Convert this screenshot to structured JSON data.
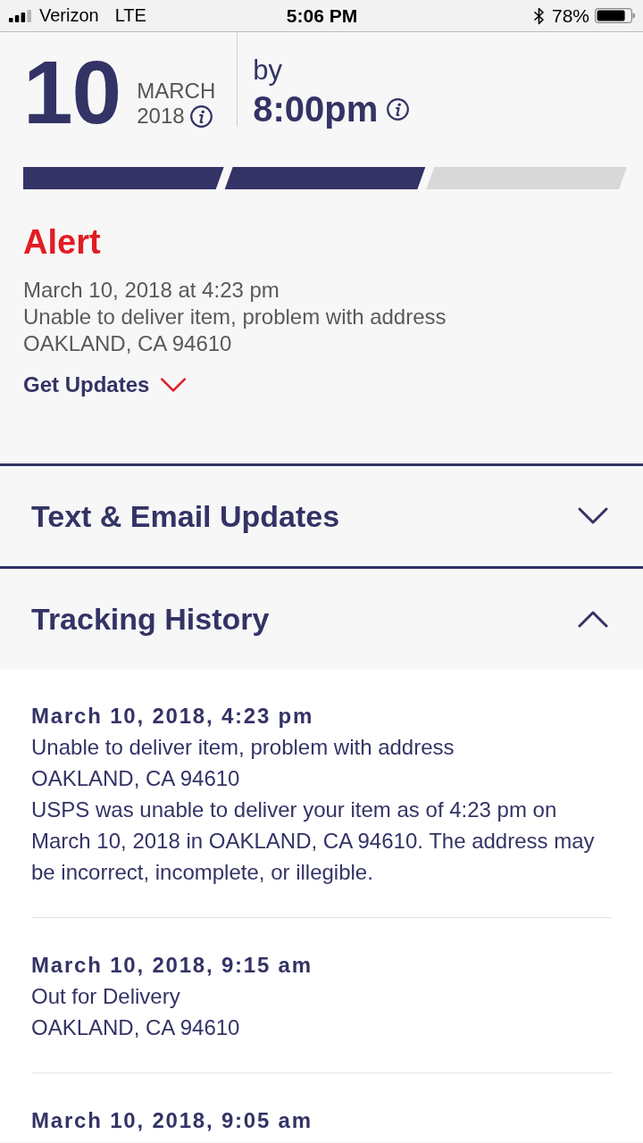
{
  "status_bar": {
    "carrier": "Verizon",
    "network": "LTE",
    "time": "5:06 PM",
    "battery": "78%"
  },
  "delivery": {
    "day": "10",
    "month": "MARCH",
    "year": "2018",
    "by_label": "by",
    "time": "8:00pm"
  },
  "progress_steps": [
    {
      "complete": true
    },
    {
      "complete": true
    },
    {
      "complete": false
    }
  ],
  "alert": {
    "title": "Alert",
    "datetime": "March 10, 2018 at 4:23 pm",
    "status": "Unable to deliver item, problem with address",
    "location": "OAKLAND, CA 94610",
    "link": "Get Updates"
  },
  "sections": [
    {
      "title": "Text & Email Updates",
      "expanded": false
    },
    {
      "title": "Tracking History",
      "expanded": true,
      "entries": [
        {
          "date": "March 10, 2018, 4:23 pm",
          "status": "Unable to deliver item, problem with address",
          "location": "OAKLAND, CA 94610",
          "details": "USPS was unable to deliver your item as of 4:23 pm on March 10, 2018 in OAKLAND, CA 94610. The address may be incorrect, incomplete, or illegible."
        },
        {
          "date": "March 10, 2018, 9:15 am",
          "status": "Out for Delivery",
          "location": "OAKLAND, CA 94610"
        },
        {
          "date": "March 10, 2018, 9:05 am"
        }
      ]
    }
  ]
}
